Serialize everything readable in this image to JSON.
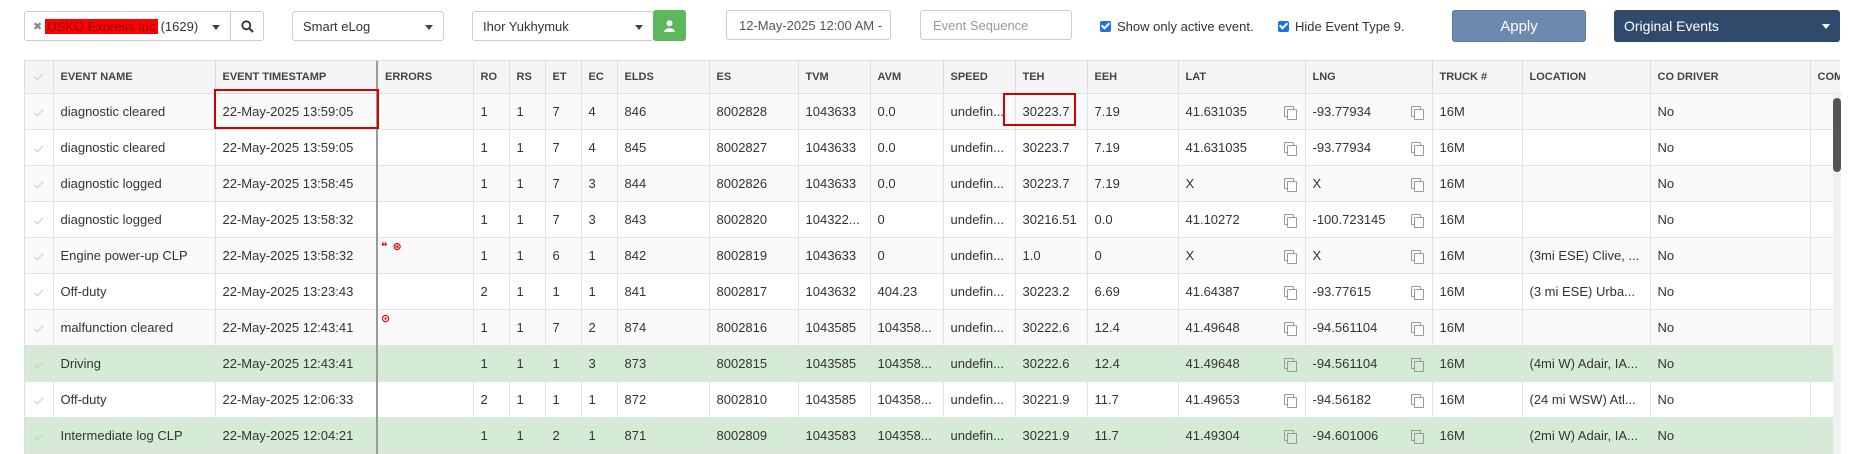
{
  "toolbar": {
    "company_name": "USKO Express Inc",
    "company_count": "(1629)",
    "elog_type": "Smart eLog",
    "driver_name": "Ihor Yukhymuk",
    "date_value": "12-May-2025 12:00 AM -",
    "event_sequence_placeholder": "Event Sequence",
    "show_active_label": "Show only active event.",
    "hide_type_label": "Hide Event Type 9.",
    "apply_label": "Apply",
    "events_mode": "Original Events"
  },
  "table": {
    "columns": [
      "EVENT NAME",
      "EVENT TIMESTAMP",
      "ERRORS",
      "RO",
      "RS",
      "ET",
      "EC",
      "ELDS",
      "ES",
      "TVM",
      "AVM",
      "SPEED",
      "TEH",
      "EEH",
      "LAT",
      "LNG",
      "TRUCK #",
      "LOCATION",
      "CO DRIVER",
      "COMM"
    ],
    "rows": [
      {
        "style": "alt",
        "errors": "",
        "cells": [
          "diagnostic cleared",
          "22-May-2025 13:59:05",
          "",
          "1",
          "1",
          "7",
          "4",
          "846",
          "8002828",
          "1043633",
          "0.0",
          "undefin...",
          "30223.7",
          "7.19",
          "41.631035",
          "-93.77934",
          "16M",
          "",
          "No",
          ""
        ]
      },
      {
        "style": "",
        "errors": "",
        "cells": [
          "diagnostic cleared",
          "22-May-2025 13:59:05",
          "",
          "1",
          "1",
          "7",
          "4",
          "845",
          "8002827",
          "1043633",
          "0.0",
          "undefin...",
          "30223.7",
          "7.19",
          "41.631035",
          "-93.77934",
          "16M",
          "",
          "No",
          ""
        ]
      },
      {
        "style": "alt",
        "errors": "",
        "cells": [
          "diagnostic logged",
          "22-May-2025 13:58:45",
          "",
          "1",
          "1",
          "7",
          "3",
          "844",
          "8002826",
          "1043633",
          "0.0",
          "undefin...",
          "30223.7",
          "7.19",
          "X",
          "X",
          "16M",
          "",
          "No",
          ""
        ]
      },
      {
        "style": "",
        "errors": "",
        "cells": [
          "diagnostic logged",
          "22-May-2025 13:58:32",
          "",
          "1",
          "1",
          "7",
          "3",
          "843",
          "8002820",
          "104322...",
          "0",
          "undefin...",
          "30216.51",
          "0.0",
          "41.10272",
          "-100.723145",
          "16M",
          "",
          "No",
          ""
        ]
      },
      {
        "style": "alt",
        "errors": "❝ ⊛",
        "cells": [
          "Engine power-up CLP",
          "22-May-2025 13:58:32",
          "",
          "1",
          "1",
          "6",
          "1",
          "842",
          "8002819",
          "1043633",
          "0",
          "undefin...",
          "1.0",
          "0",
          "X",
          "X",
          "16M",
          "(3mi ESE) Clive, ...",
          "No",
          ""
        ]
      },
      {
        "style": "",
        "errors": "",
        "cells": [
          "Off-duty",
          "22-May-2025 13:23:43",
          "",
          "2",
          "1",
          "1",
          "1",
          "841",
          "8002817",
          "1043632",
          "404.23",
          "undefin...",
          "30223.2",
          "6.69",
          "41.64387",
          "-93.77615",
          "16M",
          "(3 mi ESE) Urba...",
          "No",
          ""
        ]
      },
      {
        "style": "alt",
        "errors": "⊙",
        "cells": [
          "malfunction cleared",
          "22-May-2025 12:43:41",
          "",
          "1",
          "1",
          "7",
          "2",
          "874",
          "8002816",
          "1043585",
          "104358...",
          "undefin...",
          "30222.6",
          "12.4",
          "41.49648",
          "-94.561104",
          "16M",
          "",
          "No",
          ""
        ]
      },
      {
        "style": "green",
        "errors": "",
        "cells": [
          "Driving",
          "22-May-2025 12:43:41",
          "",
          "1",
          "1",
          "1",
          "3",
          "873",
          "8002815",
          "1043585",
          "104358...",
          "undefin...",
          "30222.6",
          "12.4",
          "41.49648",
          "-94.561104",
          "16M",
          "(4mi W) Adair, IA...",
          "No",
          ""
        ]
      },
      {
        "style": "",
        "errors": "",
        "cells": [
          "Off-duty",
          "22-May-2025 12:06:33",
          "",
          "2",
          "1",
          "1",
          "1",
          "872",
          "8002810",
          "1043585",
          "104358...",
          "undefin...",
          "30221.9",
          "11.7",
          "41.49653",
          "-94.56182",
          "16M",
          "(24 mi WSW) Atl...",
          "No",
          ""
        ]
      },
      {
        "style": "green",
        "errors": "",
        "cells": [
          "Intermediate log CLP",
          "22-May-2025 12:04:21",
          "",
          "1",
          "1",
          "2",
          "1",
          "871",
          "8002809",
          "1043583",
          "104358...",
          "undefin...",
          "30221.9",
          "11.7",
          "41.49304",
          "-94.601006",
          "16M",
          "(2mi W) Adair, IA...",
          "No",
          ""
        ]
      }
    ]
  },
  "colors": {
    "accent_green": "#5cb85c",
    "apply_button": "#6d89ad",
    "events_button": "#2f4a6b",
    "row_green": "#d6ebd6",
    "highlight_red": "#d40000"
  }
}
